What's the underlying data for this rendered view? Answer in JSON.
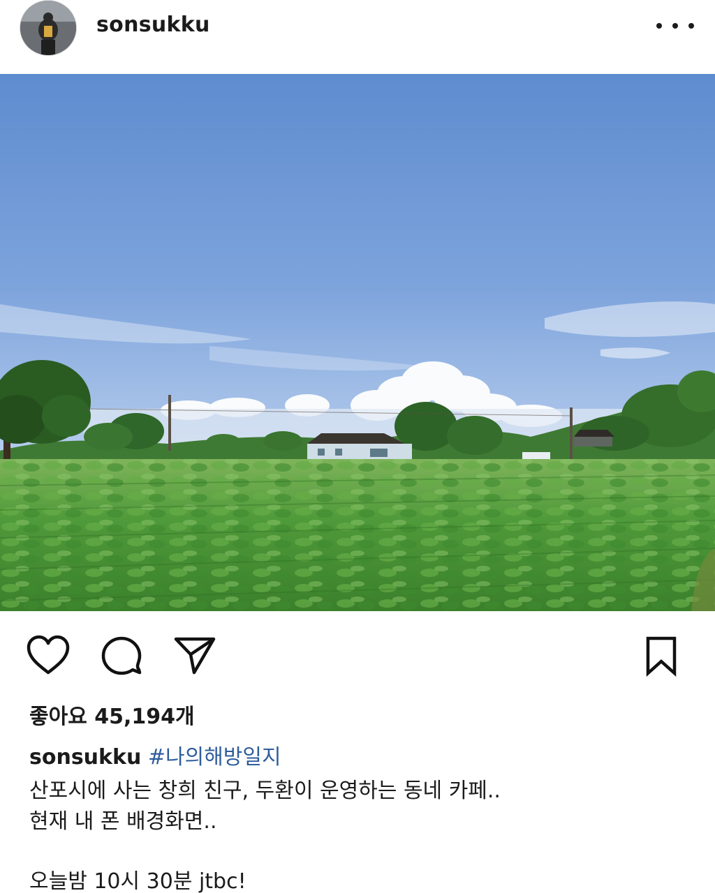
{
  "post": {
    "username": "sonsukku",
    "more_label": "more-options",
    "likes_text": "좋아요 45,194개",
    "caption": {
      "username": "sonsukku",
      "hashtag": "#나의해방일지",
      "line1": "산포시에 사는 창희 친구, 두환이 운영하는 동네 카페..",
      "line2": "현재 내 폰 배경화면..",
      "line3": "오늘밤 10시 30분 jtbc!"
    }
  },
  "icons": {
    "like": "heart-icon",
    "comment": "comment-icon",
    "share": "share-icon",
    "save": "bookmark-icon",
    "more": "more-dots-icon"
  },
  "colors": {
    "text": "#1b1b1b",
    "hashtag": "#2f5d9c",
    "sky": "#6f97d3",
    "field": "#4f9a3a"
  }
}
